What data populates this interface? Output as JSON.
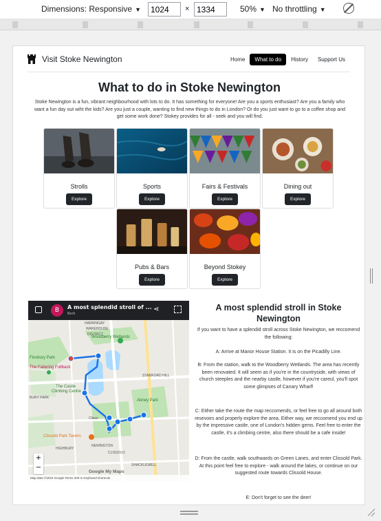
{
  "devtools": {
    "dimensions_label": "Dimensions: Responsive",
    "width": "1024",
    "height": "1334",
    "times": "×",
    "zoom": "50%",
    "throttling": "No throttling"
  },
  "nav": {
    "brand": "Visit Stoke Newington",
    "links": [
      "Home",
      "What to do",
      "History",
      "Support Us"
    ],
    "active": "What to do"
  },
  "page": {
    "title": "What to do in Stoke Newington",
    "intro": "Stoke Newington is a fun, vibrant neighbourhood with lots to do. It has something for everyone! Are you a sports enthusiast? Are you a family who want a fun day out wiht the kids? Are you just a couple, wanting to find new things to do in London? Or do you just want to go to a coffee shop and get some work done? Stokey provides for all - seek and you will find."
  },
  "cards": [
    {
      "title": "Strolls",
      "button": "Explore"
    },
    {
      "title": "Sports",
      "button": "Explore"
    },
    {
      "title": "Fairs & Festivals",
      "button": "Explore"
    },
    {
      "title": "Dining out",
      "button": "Explore"
    },
    {
      "title": "Pubs & Bars",
      "button": "Explore"
    },
    {
      "title": "Beyond Stokey",
      "button": "Explore"
    }
  ],
  "map": {
    "title": "A most splendid stroll of ...",
    "subtitle": "Berk",
    "avatar": "B",
    "labels": [
      "HARRINGAY",
      "WAREHOUSE",
      "DISTRICT",
      "Woodberry Wetlands",
      "Finsbury Park",
      "The Castle",
      "Climbing Centre",
      "The Faltering Fullback",
      "Abney Park",
      "Clissold Park Tavern",
      "STAMFORD HILL",
      "BURY PARK",
      "NEWINGTON",
      "CLISSOLD",
      "SHACKLEWELL",
      "HIGHBURY",
      "Clisso"
    ],
    "footer": "Map data ©2023 Google   Terms   200 m   Keyboard shortcuts",
    "google": "Google My Maps"
  },
  "stroll": {
    "title": "A most splendid stroll in Stoke Newington",
    "paragraphs": [
      "If you want to have a splendid stroll across Stoke Newington, we reccomend the following:",
      "A: Arrive at Manor House Station. It is on the Picadilly Line.",
      "B: From the station, walk to the Woodberry Wetlands. The area has recently been renovated. It will seem as if you're in the countryside, with views of church steeples and the nearby castle, however if you're careul, you'll spot some glimpses of Canary Wharf!",
      "C: Either take the route the map reccomends, or feel free to go all around both resevoirs and properly explore the area. Either way, we reccomend you end up by the impressive castle, one of London's hidden gems. Feel free to enter the castle, it's a climbing centre, also there should be a cafe inside!",
      "D: From the castle, walk southwards on Green Lanes, and enter Clissold Park. At this point feel free to explore - walk around the lakes, or continue on our suggested route towards Clissold House.",
      "E: Don't forget to see the deer!"
    ]
  },
  "colors": {
    "accent": "#212529",
    "map_route": "#1a73e8",
    "park_green": "#bfe3b4",
    "water": "#aadaff"
  }
}
